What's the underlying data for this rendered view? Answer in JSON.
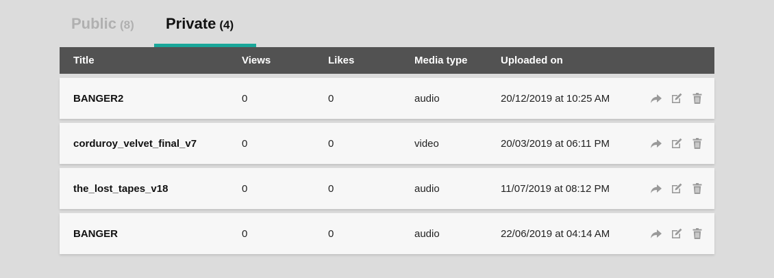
{
  "tabs": [
    {
      "label": "Public",
      "count": "(8)"
    },
    {
      "label": "Private",
      "count": "(4)"
    }
  ],
  "colors": {
    "accent": "#1aa79a",
    "header_bg": "#525252",
    "row_bg": "#f7f7f7",
    "page_bg": "#dcdcdc",
    "icon": "#9a9a9a"
  },
  "table": {
    "columns": [
      "Title",
      "Views",
      "Likes",
      "Media type",
      "Uploaded on"
    ],
    "rows": [
      {
        "title": "BANGER2",
        "views": "0",
        "likes": "0",
        "media": "audio",
        "uploaded": "20/12/2019 at 10:25 AM"
      },
      {
        "title": "corduroy_velvet_final_v7",
        "views": "0",
        "likes": "0",
        "media": "video",
        "uploaded": "20/03/2019 at 06:11 PM"
      },
      {
        "title": "the_lost_tapes_v18",
        "views": "0",
        "likes": "0",
        "media": "audio",
        "uploaded": "11/07/2019 at 08:12 PM"
      },
      {
        "title": "BANGER",
        "views": "0",
        "likes": "0",
        "media": "audio",
        "uploaded": "22/06/2019 at 04:14 AM"
      }
    ],
    "row_actions": [
      "share-icon",
      "edit-icon",
      "trash-icon"
    ]
  }
}
